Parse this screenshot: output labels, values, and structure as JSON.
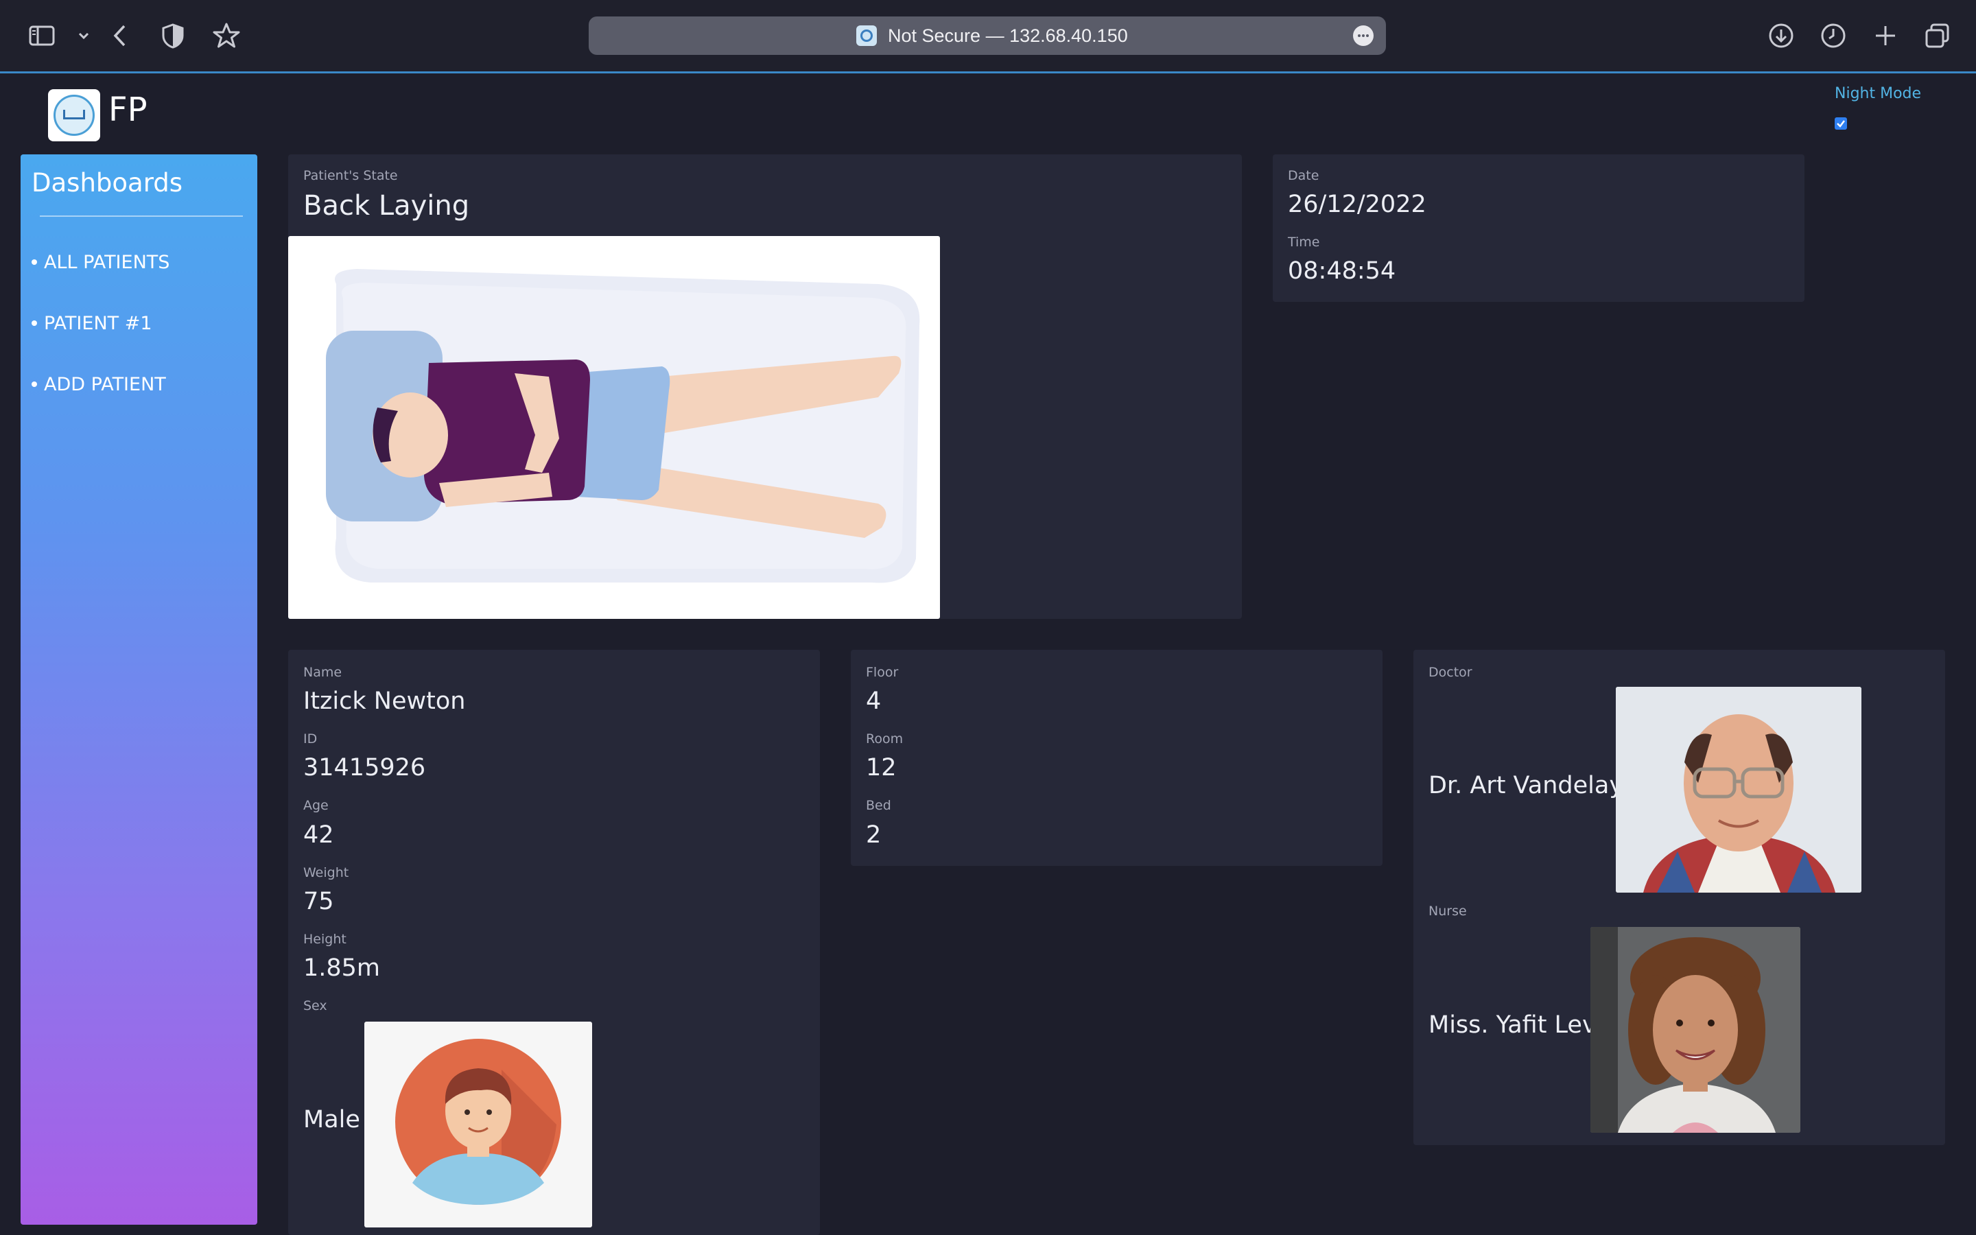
{
  "browser": {
    "url_text": "Not Secure — 132.68.40.150"
  },
  "header": {
    "brand": "FP",
    "night_mode_label": "Night Mode",
    "night_mode_checked": true
  },
  "sidebar": {
    "title": "Dashboards",
    "items": [
      {
        "label": "ALL PATIENTS"
      },
      {
        "label": "PATIENT #1"
      },
      {
        "label": "ADD PATIENT"
      }
    ]
  },
  "state_card": {
    "label": "Patient's State",
    "value": "Back Laying"
  },
  "datetime_card": {
    "date_label": "Date",
    "date": "26/12/2022",
    "time_label": "Time",
    "time": "08:48:54"
  },
  "patient_card": {
    "name_label": "Name",
    "name": "Itzick Newton",
    "id_label": "ID",
    "id": "31415926",
    "age_label": "Age",
    "age": "42",
    "weight_label": "Weight",
    "weight": "75",
    "height_label": "Height",
    "height": "1.85m",
    "sex_label": "Sex",
    "sex": "Male"
  },
  "location_card": {
    "floor_label": "Floor",
    "floor": "4",
    "room_label": "Room",
    "room": "12",
    "bed_label": "Bed",
    "bed": "2"
  },
  "staff_card": {
    "doctor_label": "Doctor",
    "doctor": "Dr. Art Vandelay",
    "nurse_label": "Nurse",
    "nurse": "Miss. Yafit Levi"
  }
}
